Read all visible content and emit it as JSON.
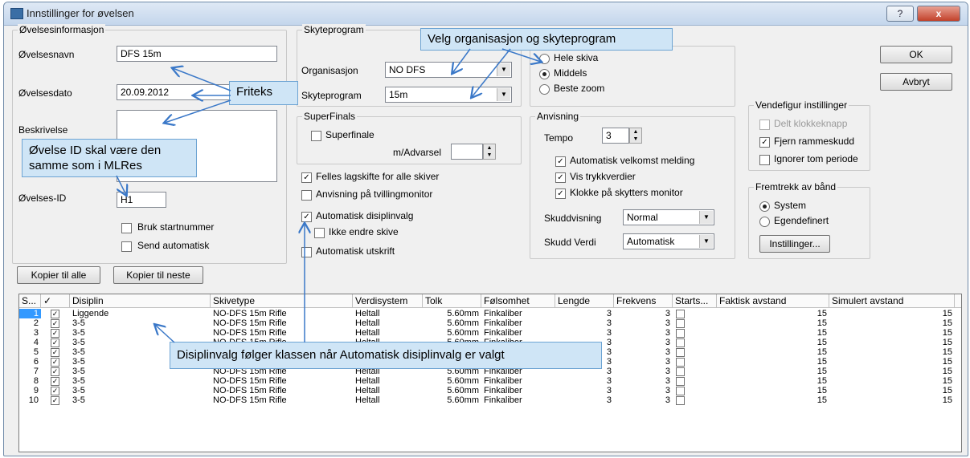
{
  "window": {
    "title": "Innstillinger for øvelsen",
    "help_label": "?",
    "close_label": "x"
  },
  "buttons": {
    "ok": "OK",
    "cancel": "Avbryt",
    "copy_all": "Kopier til alle",
    "copy_next": "Kopier til neste",
    "settings": "Instillinger..."
  },
  "ovelse": {
    "group_title": "Øvelsesinformasjon",
    "name_label": "Øvelsesnavn",
    "name_value": "DFS 15m",
    "date_label": "Øvelsesdato",
    "date_value": "20.09.2012",
    "desc_label": "Beskrivelse",
    "desc_value": "",
    "id_label": "Øvelses-ID",
    "id_value": "H1",
    "start_number": "Bruk startnummer",
    "send_auto": "Send automatisk"
  },
  "skyteprogram": {
    "group_title": "Skyteprogram",
    "org_label": "Organisasjon",
    "org_value": "NO DFS",
    "prog_label": "Skyteprogram",
    "prog_value": "15m"
  },
  "superfinals": {
    "group_title": "SuperFinals",
    "superfinale": "Superfinale",
    "advarsel_label": "m/Advarsel",
    "advarsel_value": ""
  },
  "options": {
    "felles": "Felles lagskifte for alle skiver",
    "tvilling": "Anvisning på tvillingmonitor",
    "auto_disiplin": "Automatisk disiplinvalg",
    "ikke_endre": "Ikke endre skive",
    "auto_utskrift": "Automatisk utskrift"
  },
  "zoom": {
    "hele": "Hele skiva",
    "middels": "Middels",
    "beste": "Beste zoom"
  },
  "anvisning": {
    "group_title": "Anvisning",
    "tempo_label": "Tempo",
    "tempo_value": "3",
    "velkomst": "Automatisk velkomst melding",
    "trykk": "Vis trykkverdier",
    "klokke": "Klokke på skytters monitor",
    "skuddvisning_label": "Skuddvisning",
    "skuddvisning_value": "Normal",
    "skuddverdi_label": "Skudd Verdi",
    "skuddverdi_value": "Automatisk"
  },
  "vendefigur": {
    "group_title": "Vendefigur instillinger",
    "delt": "Delt klokkeknapp",
    "fjern": "Fjern rammeskudd",
    "ignorer": "Ignorer tom periode"
  },
  "fremtrekk": {
    "group_title": "Fremtrekk av bånd",
    "system": "System",
    "egendefinert": "Egendefinert"
  },
  "callouts": {
    "velg": "Velg organisasjon og skyteprogram",
    "friteks": "Friteks",
    "ovelse_id": "Øvelse ID skal være den samme som i MLRes",
    "disiplinvalg": "Disiplinvalg følger klassen når Automatisk disiplinvalg er valgt"
  },
  "table": {
    "headers": [
      "S...",
      "✓",
      "Disiplin",
      "Skivetype",
      "Verdisystem",
      "Tolk",
      "Følsomhet",
      "Lengde",
      "Frekvens",
      "Starts...",
      "Faktisk avstand",
      "Simulert avstand"
    ],
    "rows": [
      [
        "1",
        "✓",
        "Liggende",
        "NO-DFS 15m Rifle",
        "Heltall",
        "5.60mm",
        "Finkaliber",
        "3",
        "3",
        "",
        "15",
        "15"
      ],
      [
        "2",
        "✓",
        "3-5",
        "NO-DFS 15m Rifle",
        "Heltall",
        "5.60mm",
        "Finkaliber",
        "3",
        "3",
        "",
        "15",
        "15"
      ],
      [
        "3",
        "✓",
        "3-5",
        "NO-DFS 15m Rifle",
        "Heltall",
        "5.60mm",
        "Finkaliber",
        "3",
        "3",
        "",
        "15",
        "15"
      ],
      [
        "4",
        "✓",
        "3-5",
        "NO-DFS 15m Rifle",
        "Heltall",
        "5.60mm",
        "Finkaliber",
        "3",
        "3",
        "",
        "15",
        "15"
      ],
      [
        "5",
        "✓",
        "3-5",
        "",
        "",
        "",
        "",
        "3",
        "3",
        "",
        "15",
        "15"
      ],
      [
        "6",
        "✓",
        "3-5",
        "",
        "",
        "",
        "",
        "3",
        "3",
        "",
        "15",
        "15"
      ],
      [
        "7",
        "✓",
        "3-5",
        "NO-DFS 15m Rifle",
        "Heltall",
        "5.60mm",
        "Finkaliber",
        "3",
        "3",
        "",
        "15",
        "15"
      ],
      [
        "8",
        "✓",
        "3-5",
        "NO-DFS 15m Rifle",
        "Heltall",
        "5.60mm",
        "Finkaliber",
        "3",
        "3",
        "",
        "15",
        "15"
      ],
      [
        "9",
        "✓",
        "3-5",
        "NO-DFS 15m Rifle",
        "Heltall",
        "5.60mm",
        "Finkaliber",
        "3",
        "3",
        "",
        "15",
        "15"
      ],
      [
        "10",
        "✓",
        "3-5",
        "NO-DFS 15m Rifle",
        "Heltall",
        "5.60mm",
        "Finkaliber",
        "3",
        "3",
        "",
        "15",
        "15"
      ]
    ]
  },
  "colors": {
    "callout_bg": "#cfe5f6",
    "arrow": "#3a78c8",
    "selection": "#3399ff"
  }
}
